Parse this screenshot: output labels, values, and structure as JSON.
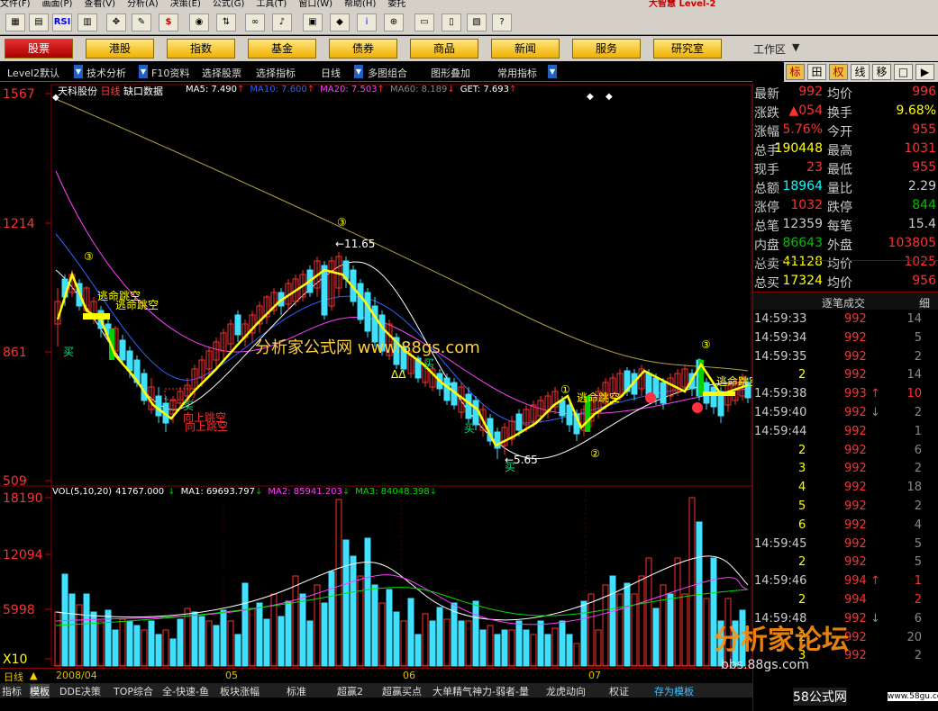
{
  "menu": {
    "items": [
      "文件(F)",
      "画面(P)",
      "查看(V)",
      "分析(A)",
      "决策(E)",
      "公式(G)",
      "工具(T)",
      "窗口(W)",
      "帮助(H)",
      "委托"
    ],
    "brand": "大智慧 Level-2"
  },
  "toolbar": {
    "icons": [
      "chart-icon",
      "panel-icon",
      "rsi-icon",
      "grid-icon",
      "move-icon",
      "pen-icon",
      "dollar-icon",
      "eye-icon",
      "sort-icon",
      "binoculars-icon",
      "alarm-icon",
      "news-icon",
      "diamond-icon",
      "info-icon",
      "link-icon",
      "note-icon",
      "book-icon",
      "calc-icon",
      "help-icon"
    ],
    "rsi_label": "RSI",
    "dollar_label": "$",
    "info_label": "i",
    "help_label": "?"
  },
  "categories": [
    "股票",
    "港股",
    "指数",
    "基金",
    "债券",
    "商品",
    "新闻",
    "服务",
    "研究室"
  ],
  "workspace": "工作区",
  "subbar": {
    "items": [
      "Level2默认",
      "技术分析",
      "F10资料",
      "选择股票",
      "选择指标",
      "日线",
      "多图组合",
      "图形叠加",
      "常用指标"
    ]
  },
  "right_tabs": [
    "标",
    "田",
    "权",
    "线",
    "移",
    "□",
    "▶"
  ],
  "chart": {
    "stock": "天科股份",
    "period": "日线",
    "gap_label": "缺口数据",
    "ma": [
      {
        "label": "MA5: 7.490",
        "arrow": "↑",
        "color": "#ffffff"
      },
      {
        "label": "MA10: 7.600",
        "arrow": "↑",
        "color": "#3060ff"
      },
      {
        "label": "MA20: 7.503",
        "arrow": "↑",
        "color": "#ff40ff"
      },
      {
        "label": "MA60: 8.189",
        "arrow": "↓",
        "color": "#888888"
      },
      {
        "label": "GET: 7.693",
        "arrow": "↑",
        "color": "#ffffff"
      }
    ],
    "price_ticks": [
      "1567",
      "1214",
      "861",
      "509"
    ],
    "vol_ticks": [
      "18190",
      "12094",
      "5998",
      "X10"
    ],
    "vol_title": "VOL(5,10,20)",
    "vol_value": "41767.000",
    "vol_arrow": "↓",
    "vol_ma": [
      {
        "label": "MA1: 69693.797",
        "arrow": "↓",
        "color": "#ffffff"
      },
      {
        "label": "MA2: 85941.203",
        "arrow": "↓",
        "color": "#ff40ff"
      },
      {
        "label": "MA3: 84048.398",
        "arrow": "↓",
        "color": "#00e000"
      }
    ],
    "annotations": [
      "逃命跳空",
      "逃命跳空",
      "向上跳空",
      "向上跳空",
      "逃命跳空",
      "逃命跳空",
      "买",
      "买",
      "买",
      "买",
      "买",
      "←11.65",
      "←5.65",
      "①",
      "②",
      "③",
      "③",
      "③",
      "③",
      "ΔΔ"
    ],
    "center_watermark": "分析家公式网 www.88gs.com",
    "dates": [
      "2008/04",
      "05",
      "06",
      "07"
    ],
    "period_bottom": "日线"
  },
  "bottom_tabs": [
    "指标",
    "模板",
    "DDE决策",
    "TOP综合",
    "全-快速-鱼",
    "板块涨幅",
    "标准",
    "超赢2",
    "超赢买点",
    "大单精气神力-弱者-量",
    "龙虎动向",
    "权证",
    "存为模板"
  ],
  "quote": {
    "rows": [
      {
        "l1": "最新",
        "v1": "992",
        "c1": "#ff3030",
        "l2": "均价",
        "v2": "996",
        "c2": "#ff3030"
      },
      {
        "l1": "涨跌",
        "v1": "▲054",
        "c1": "#ff3030",
        "l2": "换手",
        "v2": "9.68%",
        "c2": "#ffff00"
      },
      {
        "l1": "涨幅",
        "v1": "5.76%",
        "c1": "#ff3030",
        "l2": "今开",
        "v2": "955",
        "c2": "#ff3030"
      },
      {
        "l1": "总手",
        "v1": "190448",
        "c1": "#ffff00",
        "l2": "最高",
        "v2": "1031",
        "c2": "#ff3030"
      },
      {
        "l1": "现手",
        "v1": "23",
        "c1": "#ff3030",
        "l2": "最低",
        "v2": "955",
        "c2": "#ff3030"
      },
      {
        "l1": "总额",
        "v1": "18964",
        "c1": "#00ffff",
        "l2": "量比",
        "v2": "2.29",
        "c2": "#cccccc"
      },
      {
        "l1": "涨停",
        "v1": "1032",
        "c1": "#ff3030",
        "l2": "跌停",
        "v2": "844",
        "c2": "#00c000"
      },
      {
        "l1": "总笔",
        "v1": "12359",
        "c1": "#cccccc",
        "l2": "每笔",
        "v2": "15.4",
        "c2": "#cccccc"
      },
      {
        "l1": "内盘",
        "v1": "86643",
        "c1": "#00c000",
        "l2": "外盘",
        "v2": "103805",
        "c2": "#ff3030"
      },
      {
        "l1": "总卖",
        "v1": "41128",
        "c1": "#ffff00",
        "l2": "均价",
        "v2": "1025",
        "c2": "#ff3030"
      },
      {
        "l1": "总买",
        "v1": "17324",
        "c1": "#ffff00",
        "l2": "均价",
        "v2": "956",
        "c2": "#ff3030"
      }
    ],
    "ticks_title": "逐笔成交",
    "ticks_side": "细",
    "ticks": [
      {
        "time": "14:59:33",
        "price": "992",
        "arrow": "",
        "vol": "14",
        "vc": "#888888"
      },
      {
        "time": "14:59:34",
        "price": "992",
        "arrow": "",
        "vol": "5",
        "vc": "#888888"
      },
      {
        "time": "14:59:35",
        "price": "992",
        "arrow": "",
        "vol": "2",
        "vc": "#888888"
      },
      {
        "time": "2",
        "price": "992",
        "arrow": "",
        "vol": "14",
        "vc": "#888888"
      },
      {
        "time": "14:59:38",
        "price": "993",
        "arrow": "↑",
        "vol": "10",
        "vc": "#ff3030"
      },
      {
        "time": "14:59:40",
        "price": "992",
        "arrow": "↓",
        "vol": "2",
        "vc": "#888888"
      },
      {
        "time": "14:59:44",
        "price": "992",
        "arrow": "",
        "vol": "1",
        "vc": "#888888"
      },
      {
        "time": "2",
        "price": "992",
        "arrow": "",
        "vol": "6",
        "vc": "#888888"
      },
      {
        "time": "3",
        "price": "992",
        "arrow": "",
        "vol": "2",
        "vc": "#888888"
      },
      {
        "time": "4",
        "price": "992",
        "arrow": "",
        "vol": "18",
        "vc": "#888888"
      },
      {
        "time": "5",
        "price": "992",
        "arrow": "",
        "vol": "2",
        "vc": "#888888"
      },
      {
        "time": "6",
        "price": "992",
        "arrow": "",
        "vol": "4",
        "vc": "#888888"
      },
      {
        "time": "14:59:45",
        "price": "992",
        "arrow": "",
        "vol": "5",
        "vc": "#888888"
      },
      {
        "time": "2",
        "price": "992",
        "arrow": "",
        "vol": "5",
        "vc": "#888888"
      },
      {
        "time": "14:59:46",
        "price": "994",
        "arrow": "↑",
        "vol": "1",
        "vc": "#ff3030"
      },
      {
        "time": "2",
        "price": "994",
        "arrow": "",
        "vol": "2",
        "vc": "#ff3030"
      },
      {
        "time": "14:59:48",
        "price": "992",
        "arrow": "↓",
        "vol": "6",
        "vc": "#888888"
      },
      {
        "time": "2",
        "price": "992",
        "arrow": "",
        "vol": "20",
        "vc": "#888888"
      },
      {
        "time": "3",
        "price": "992",
        "arrow": "",
        "vol": "2",
        "vc": "#888888"
      }
    ]
  },
  "watermarks": {
    "logo": "分析家论坛",
    "url": "bbs.88gs.com",
    "site": "58公式网",
    "site_url": "www.58gu.com"
  }
}
